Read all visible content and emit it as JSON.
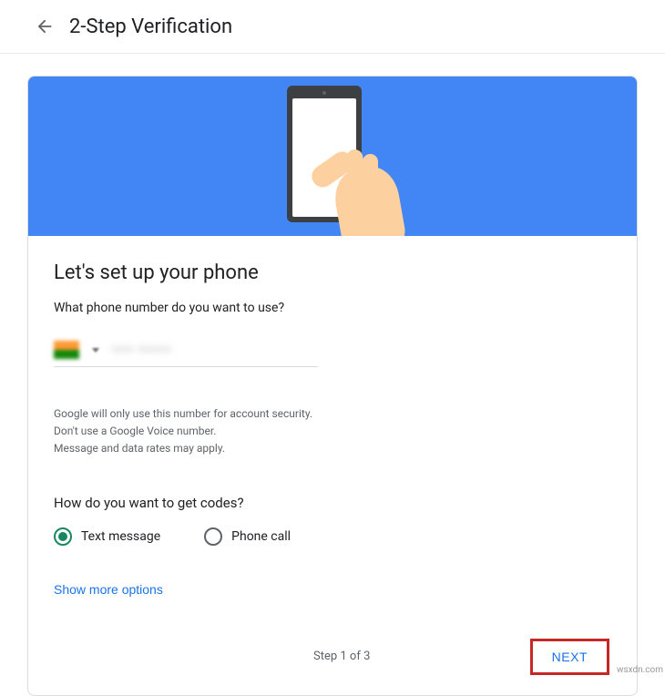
{
  "header": {
    "title": "2-Step Verification"
  },
  "main": {
    "heading": "Let's set up your phone",
    "subheading": "What phone number do you want to use?",
    "phone_value": "•••• ••••••",
    "disclaimer_line1": "Google will only use this number for account security.",
    "disclaimer_line2": "Don't use a Google Voice number.",
    "disclaimer_line3": "Message and data rates may apply.",
    "codes_question": "How do you want to get codes?",
    "radio_options": [
      {
        "label": "Text message",
        "selected": true
      },
      {
        "label": "Phone call",
        "selected": false
      }
    ],
    "show_more_label": "Show more options",
    "step_text": "Step 1 of 3",
    "next_label": "NEXT"
  },
  "watermark": "wsxdn.com"
}
